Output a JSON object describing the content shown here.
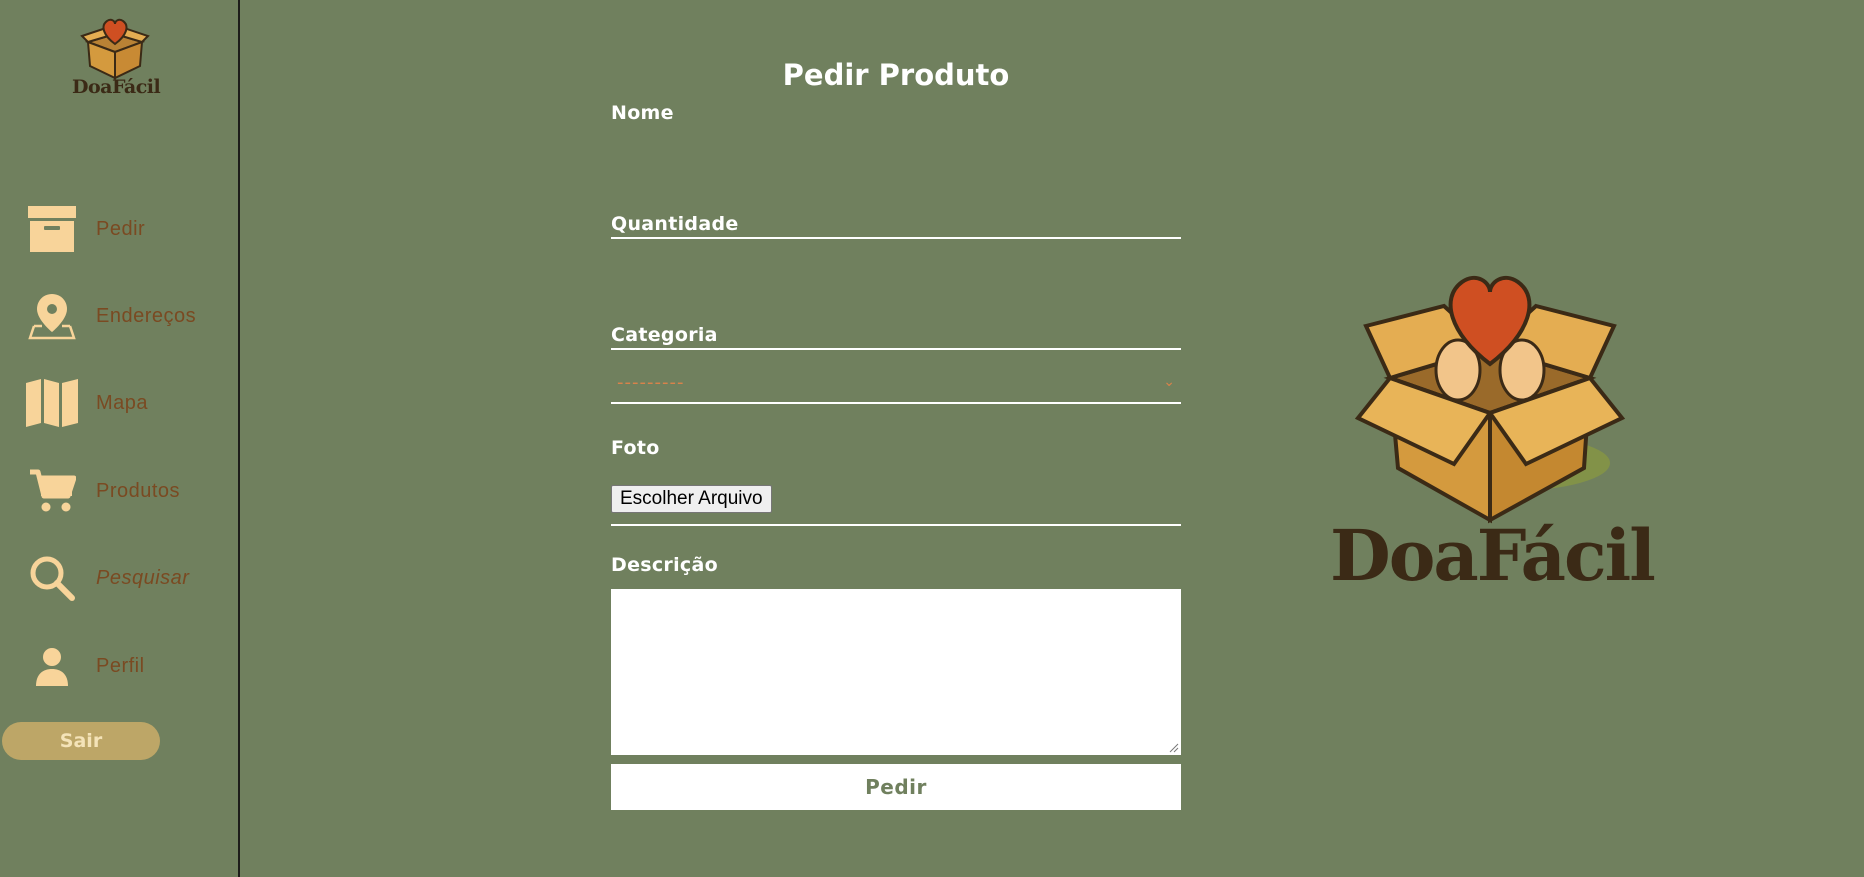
{
  "brand": {
    "name": "DoaFácil"
  },
  "sidebar": {
    "items": [
      {
        "label": "Pedir",
        "icon": "archive-box-icon"
      },
      {
        "label": "Endereços",
        "icon": "map-pin-icon"
      },
      {
        "label": "Mapa",
        "icon": "folded-map-icon"
      },
      {
        "label": "Produtos",
        "icon": "shopping-cart-icon"
      },
      {
        "label": "Pesquisar",
        "icon": "search-icon"
      },
      {
        "label": "Perfil",
        "icon": "user-icon"
      }
    ],
    "logout_label": "Sair"
  },
  "form": {
    "title": "Pedir Produto",
    "nome_label": "Nome",
    "nome_value": "",
    "quantidade_label": "Quantidade",
    "quantidade_value": "",
    "categoria_label": "Categoria",
    "categoria_selected": "---------",
    "foto_label": "Foto",
    "foto_button": "Escolher Arquivo",
    "descricao_label": "Descrição",
    "descricao_value": "",
    "submit_label": "Pedir"
  },
  "colors": {
    "background": "#70805e",
    "icon": "#f8d49a",
    "nav_text": "#7a4a22",
    "logout_button": "#bda667",
    "accent_orange": "#d9824a"
  }
}
